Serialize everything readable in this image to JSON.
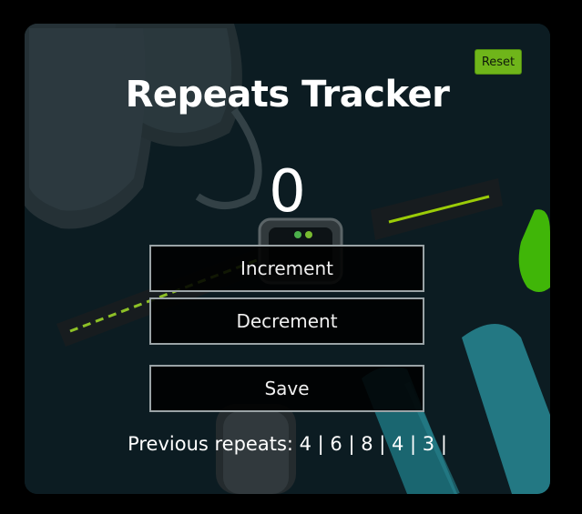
{
  "app": {
    "title": "Repeats Tracker",
    "count": "0",
    "reset_label": "Reset",
    "increment_label": "Increment",
    "decrement_label": "Decrement",
    "save_label": "Save",
    "previous_label": "Previous repeats: 4 | 6 | 8 | 4 | 3 |"
  },
  "colors": {
    "accent": "#6fb51a",
    "background": "#0d1b21",
    "text": "#ffffff"
  },
  "background_image": {
    "icons": [
      "sneaker-icon",
      "smartwatch-icon",
      "dumbbell-icon",
      "earbuds-case-icon",
      "kettlebell-icon"
    ]
  }
}
